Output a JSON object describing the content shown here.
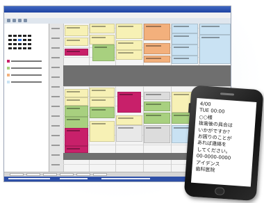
{
  "phone": {
    "date": "4/00",
    "day_time": "TUE 00:00",
    "salutation": "○○様",
    "message_lines": [
      "抜歯後の具合は",
      "いかがですか？",
      "お困りのことが",
      "あれば連絡を",
      "してください。"
    ],
    "phone_number": "00-0000-0000",
    "clinic_lines": [
      "アイデンス",
      "歯科医院"
    ]
  },
  "colors": {
    "titlebar": "#2a4fae",
    "lunch_band": "#6f6f6f",
    "appt_yellow": "#f7f1b5",
    "appt_magenta": "#c8206a",
    "appt_green": "#a8d07f",
    "appt_orange": "#f3b07c",
    "appt_blue": "#c9e2f3"
  },
  "icons": [
    "calendar-icon",
    "toolbar-icon"
  ]
}
